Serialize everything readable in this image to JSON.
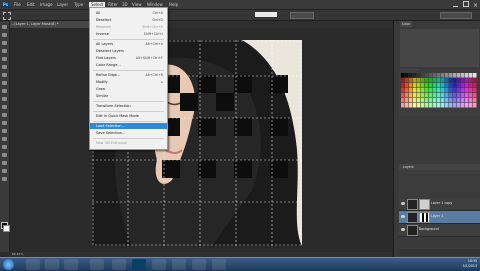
{
  "app": {
    "logo": "Ps"
  },
  "menubar": {
    "items": [
      "File",
      "Edit",
      "Image",
      "Layer",
      "Type",
      "Select",
      "Filter",
      "3D",
      "View",
      "Window",
      "Help"
    ]
  },
  "document": {
    "tab_title": "...(Layer 1, Layer Mask/8) *"
  },
  "status": {
    "zoom": "66.67%"
  },
  "select_menu": {
    "items": [
      {
        "label": "All",
        "shortcut": "Ctrl+A",
        "disabled": false
      },
      {
        "label": "Deselect",
        "shortcut": "Ctrl+D",
        "disabled": false
      },
      {
        "label": "Reselect",
        "shortcut": "Shift+Ctrl+D",
        "disabled": true
      },
      {
        "label": "Inverse",
        "shortcut": "Shift+Ctrl+I",
        "disabled": false
      },
      {
        "label": "All Layers",
        "shortcut": "Alt+Ctrl+A",
        "disabled": false
      },
      {
        "label": "Deselect Layers",
        "shortcut": "",
        "disabled": false
      },
      {
        "label": "Find Layers",
        "shortcut": "Alt+Shift+Ctrl+F",
        "disabled": false
      },
      {
        "label": "Color Range...",
        "shortcut": "",
        "disabled": false
      },
      {
        "label": "Refine Edge...",
        "shortcut": "Alt+Ctrl+R",
        "disabled": false
      },
      {
        "label": "Modify",
        "shortcut": "▸",
        "disabled": false
      },
      {
        "label": "Grow",
        "shortcut": "",
        "disabled": false
      },
      {
        "label": "Similar",
        "shortcut": "",
        "disabled": false
      },
      {
        "label": "Transform Selection",
        "shortcut": "",
        "disabled": false
      },
      {
        "label": "Edit in Quick Mask Mode",
        "shortcut": "",
        "disabled": false
      },
      {
        "label": "Load Selection...",
        "shortcut": "",
        "disabled": false
      },
      {
        "label": "Save Selection...",
        "shortcut": "",
        "disabled": false
      },
      {
        "label": "New 3D Extrusion",
        "shortcut": "",
        "disabled": true
      }
    ],
    "highlighted_index": 14
  },
  "layers_panel": {
    "tab": "Layers",
    "layers": [
      {
        "name": "Layer 1 copy",
        "selected": false
      },
      {
        "name": "Layer 1",
        "selected": true
      },
      {
        "name": "Background",
        "selected": false
      }
    ]
  },
  "right_panels": {
    "top_tab": "Color",
    "swatches_tab": "Swatches"
  },
  "taskbar": {
    "time": "10:35",
    "date": "5/1/2013"
  },
  "colors": {
    "accent": "#2e8ad6",
    "panel": "#3a3a3a",
    "canvas_bg": "#2b2b2b"
  }
}
